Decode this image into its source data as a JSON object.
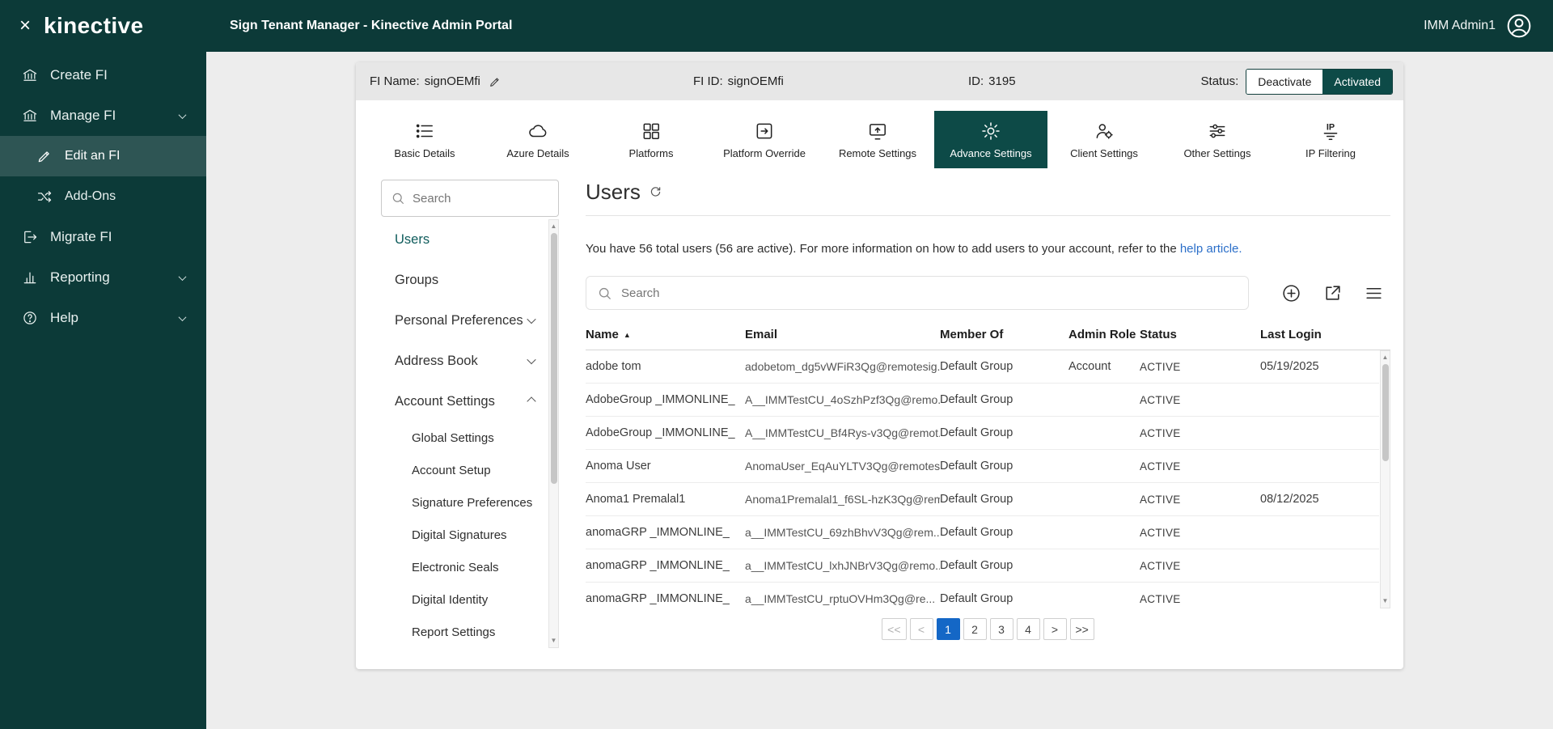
{
  "icons": {
    "close": "×",
    "sort_asc": "▲",
    "scroll_up": "▲",
    "scroll_down": "▼"
  },
  "colors": {
    "brand_dark": "#0c3a38",
    "active_teal": "#0d4a47",
    "link_blue": "#2b6fc9",
    "pagination_active_blue": "#1467c6"
  },
  "topbar": {
    "title": "Sign Tenant Manager - Kinective Admin Portal",
    "user_name": "IMM Admin1"
  },
  "sidebar": {
    "logo": "kinective",
    "items": [
      {
        "label": "Create FI"
      },
      {
        "label": "Manage FI",
        "expanded": true
      },
      {
        "label": "Edit an FI",
        "active": true
      },
      {
        "label": "Add-Ons"
      },
      {
        "label": "Migrate FI"
      },
      {
        "label": "Reporting",
        "expandable": true
      },
      {
        "label": "Help",
        "expandable": true
      }
    ]
  },
  "fi_header": {
    "name_label": "FI Name:",
    "name_value": "signOEMfi",
    "fi_id_label": "FI ID:",
    "fi_id_value": "signOEMfi",
    "id_label": "ID:",
    "id_value": "3195",
    "status_label": "Status:",
    "deactivate": "Deactivate",
    "activated": "Activated"
  },
  "tabs": [
    {
      "label": "Basic Details"
    },
    {
      "label": "Azure Details"
    },
    {
      "label": "Platforms"
    },
    {
      "label": "Platform Override"
    },
    {
      "label": "Remote Settings"
    },
    {
      "label": "Advance Settings",
      "active": true
    },
    {
      "label": "Client Settings"
    },
    {
      "label": "Other Settings"
    },
    {
      "label": "IP Filtering"
    }
  ],
  "settings_nav": {
    "search_placeholder": "Search",
    "items": [
      {
        "label": "Users",
        "active": true
      },
      {
        "label": "Groups"
      },
      {
        "label": "Personal Preferences",
        "chevron": "down"
      },
      {
        "label": "Address Book",
        "chevron": "down"
      },
      {
        "label": "Account Settings",
        "chevron": "up"
      }
    ],
    "account_settings_children": [
      "Global Settings",
      "Account Setup",
      "Signature Preferences",
      "Digital Signatures",
      "Electronic Seals",
      "Digital Identity",
      "Report Settings"
    ]
  },
  "users": {
    "title": "Users",
    "info_text": "You have 56 total users (56 are active). For more information on how to add users to your account, refer to the",
    "info_link": "help article.",
    "search_placeholder": "Search",
    "table": {
      "headers": [
        "Name",
        "Email",
        "Member Of",
        "Admin Role",
        "Status",
        "Last Login"
      ],
      "rows": [
        {
          "name": "adobe tom",
          "email": "adobetom_dg5vWFiR3Qg@remotesig...",
          "member_of": "Default Group",
          "admin_role": "Account",
          "status": "ACTIVE",
          "last_login": "05/19/2025"
        },
        {
          "name": "AdobeGroup _IMMONLINE_",
          "email": "A__IMMTestCU_4oSzhPzf3Qg@remo...",
          "member_of": "Default Group",
          "admin_role": "",
          "status": "ACTIVE",
          "last_login": ""
        },
        {
          "name": "AdobeGroup _IMMONLINE_",
          "email": "A__IMMTestCU_Bf4Rys-v3Qg@remot...",
          "member_of": "Default Group",
          "admin_role": "",
          "status": "ACTIVE",
          "last_login": ""
        },
        {
          "name": "Anoma User",
          "email": "AnomaUser_EqAuYLTV3Qg@remotes...",
          "member_of": "Default Group",
          "admin_role": "",
          "status": "ACTIVE",
          "last_login": ""
        },
        {
          "name": "Anoma1 Premalal1",
          "email": "Anoma1Premalal1_f6SL-hzK3Qg@rem...",
          "member_of": "Default Group",
          "admin_role": "",
          "status": "ACTIVE",
          "last_login": "08/12/2025"
        },
        {
          "name": "anomaGRP _IMMONLINE_",
          "email": "a__IMMTestCU_69zhBhvV3Qg@rem...",
          "member_of": "Default Group",
          "admin_role": "",
          "status": "ACTIVE",
          "last_login": ""
        },
        {
          "name": "anomaGRP _IMMONLINE_",
          "email": "a__IMMTestCU_lxhJNBrV3Qg@remo...",
          "member_of": "Default Group",
          "admin_role": "",
          "status": "ACTIVE",
          "last_login": ""
        },
        {
          "name": "anomaGRP _IMMONLINE_",
          "email": "a__IMMTestCU_rptuOVHm3Qg@re...",
          "member_of": "Default Group",
          "admin_role": "",
          "status": "ACTIVE",
          "last_login": ""
        }
      ]
    },
    "pagination": {
      "buttons": [
        "<<",
        "<",
        "1",
        "2",
        "3",
        "4",
        ">",
        ">>"
      ],
      "active_page": "1"
    }
  }
}
